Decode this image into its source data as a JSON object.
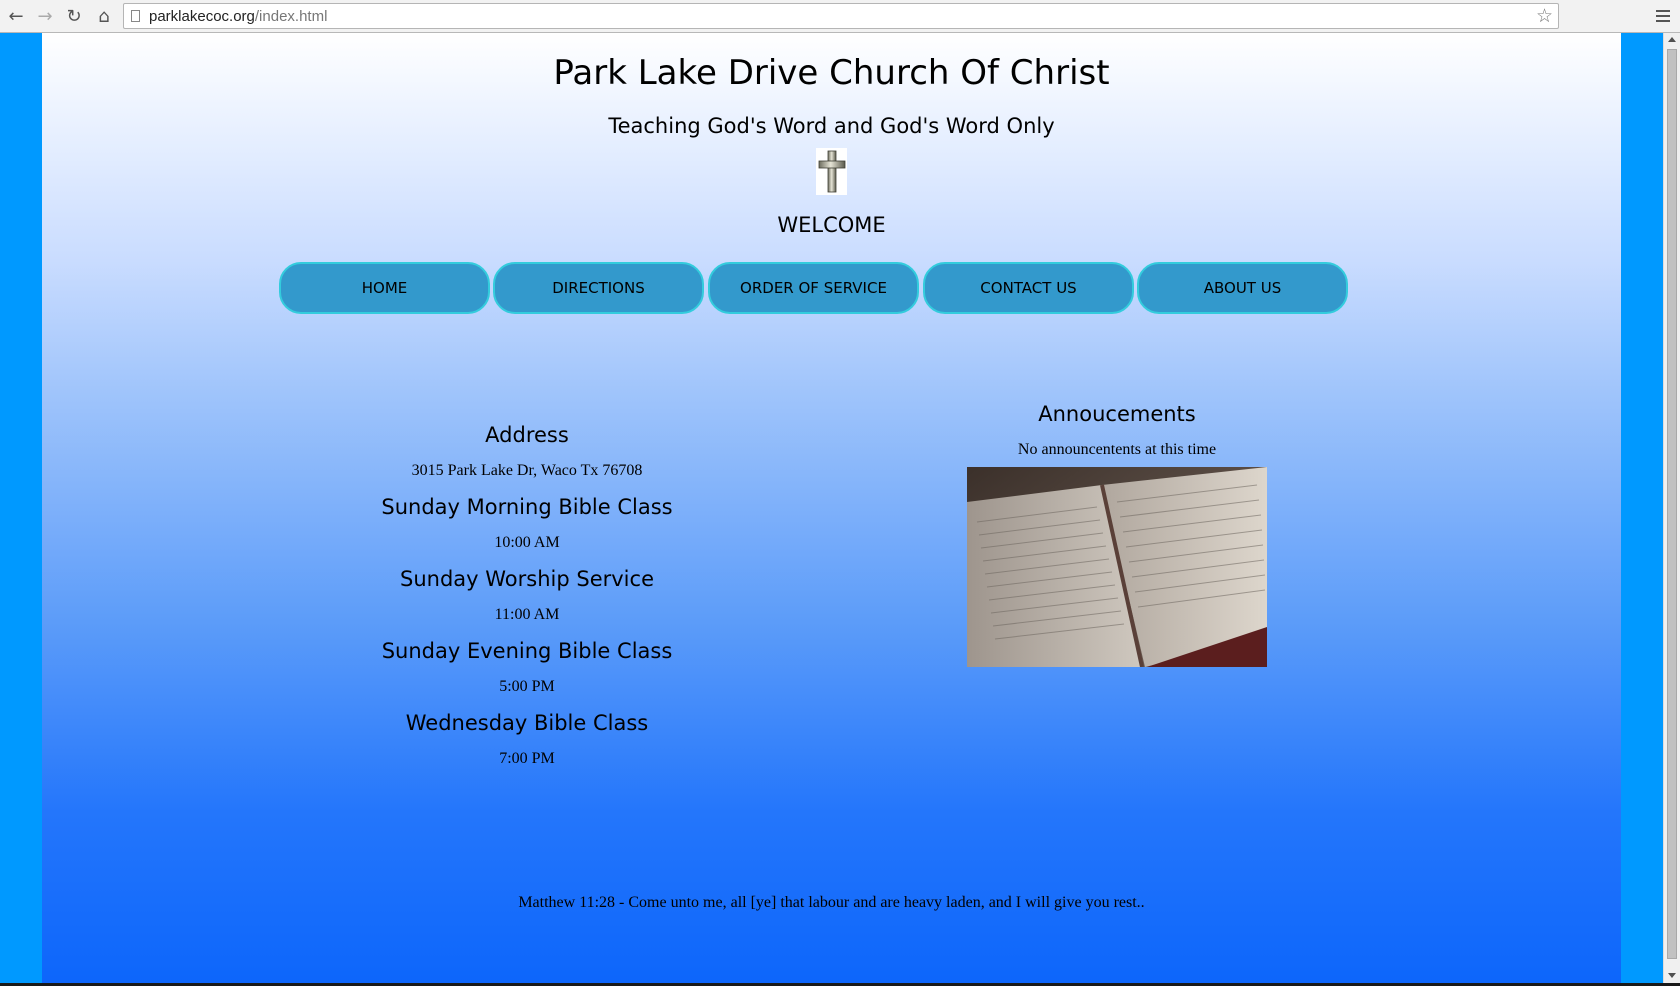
{
  "browser": {
    "url_host": "parklakecoc.org",
    "url_path": "/index.html"
  },
  "header": {
    "title": "Park Lake Drive Church Of Christ",
    "tagline": "Teaching God's Word and God's Word Only",
    "welcome": "WELCOME"
  },
  "nav": {
    "home": "HOME",
    "directions": "DIRECTIONS",
    "order_of_service": "ORDER OF SERVICE",
    "contact_us": "CONTACT US",
    "about_us": "ABOUT US"
  },
  "info": {
    "address_heading": "Address",
    "address": "3015 Park Lake Dr, Waco Tx 76708",
    "schedule": [
      {
        "heading": "Sunday Morning Bible Class",
        "time": "10:00 AM"
      },
      {
        "heading": "Sunday Worship Service",
        "time": "11:00 AM"
      },
      {
        "heading": "Sunday Evening Bible Class",
        "time": "5:00 PM"
      },
      {
        "heading": "Wednesday Bible Class",
        "time": "7:00 PM"
      }
    ]
  },
  "announcements": {
    "heading": "Annoucements",
    "text": "No announcentents at this time"
  },
  "footer": {
    "verse": "Matthew 11:28 - Come unto me, all [ye] that labour and are heavy laden, and I will give you rest.."
  },
  "colors": {
    "page_side": "#0099ff",
    "nav_button": "#3399cc",
    "nav_border": "#33ccdd"
  }
}
